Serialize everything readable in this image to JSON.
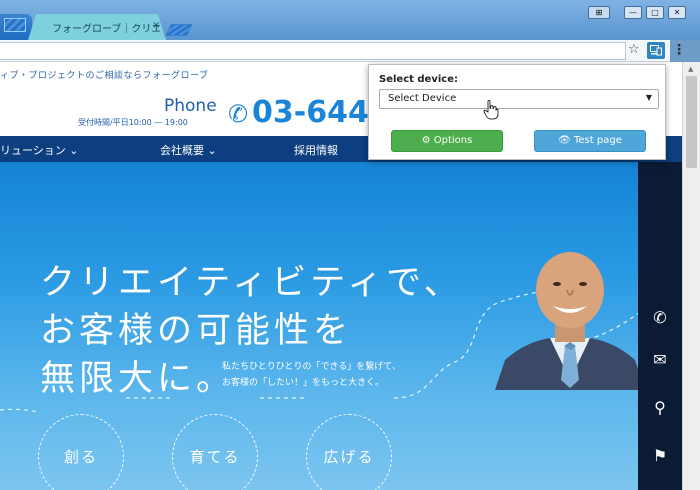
{
  "browser": {
    "active_tab_title": "フォーグローブ｜クリエイティ",
    "tab_close": "×"
  },
  "window_buttons": {
    "user": "⊞",
    "minimize": "—",
    "maximize": "□",
    "close": "✕"
  },
  "toolbar": {
    "bookmark_star": "☆",
    "menu_dots": "⋮"
  },
  "site": {
    "tagline": "ィブ・プロジェクトのご相談ならフォーグローブ",
    "phone_label": "Phone",
    "hours": "受付時間/平日10:00 ― 19:00",
    "phone_icon": "✆",
    "phone_number": "03-6447",
    "nav": [
      {
        "label": "リューション ⌄"
      },
      {
        "label": "会社概要 ⌄"
      },
      {
        "label": "採用情報"
      }
    ],
    "hero": {
      "lines": [
        "クリエイティビティで、",
        "お客様の可能性を",
        "無限大に。"
      ],
      "subtext": [
        "私たちひとりひとりの「できる」を繋げて、",
        "お客様の「したい！」をもっと大きく。"
      ],
      "circles": [
        "創る",
        "育てる",
        "広げる"
      ]
    },
    "side_icons": [
      {
        "icon": "phone-icon",
        "glyph": "✆"
      },
      {
        "icon": "mail-icon",
        "glyph": "✉"
      },
      {
        "icon": "search-icon",
        "glyph": "⚲"
      },
      {
        "icon": "map-pin-icon",
        "glyph": "⚑"
      },
      {
        "icon": "users-icon",
        "glyph": "👥"
      }
    ]
  },
  "popup": {
    "label": "Select device:",
    "select_value": "Select Device",
    "options_button": "⚙ Options",
    "test_button": "👁 Test page"
  },
  "colors": {
    "nav_bg": "#0c3e80",
    "accent_blue": "#1a84d8",
    "options_green": "#4cae4c",
    "test_blue": "#4fa6d8"
  }
}
